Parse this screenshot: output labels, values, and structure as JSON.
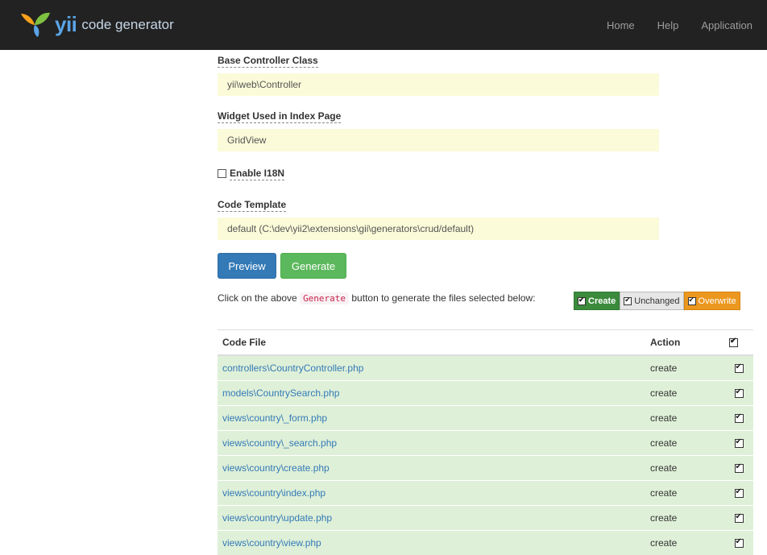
{
  "navbar": {
    "brand_logo": "yii",
    "brand_subtitle": "code generator",
    "links": [
      "Home",
      "Help",
      "Application"
    ]
  },
  "form": {
    "base_controller": {
      "label": "Base Controller Class",
      "value": "yii\\web\\Controller"
    },
    "widget": {
      "label": "Widget Used in Index Page",
      "value": "GridView"
    },
    "i18n": {
      "label": "Enable I18N",
      "checked": false
    },
    "template": {
      "label": "Code Template",
      "value": "default (C:\\dev\\yii2\\extensions\\gii\\generators\\crud/default)"
    }
  },
  "buttons": {
    "preview": "Preview",
    "generate": "Generate"
  },
  "hint": {
    "before": "Click on the above ",
    "code": "Generate",
    "after": " button to generate the files selected below:"
  },
  "legend": {
    "create": "Create",
    "unchanged": "Unchanged",
    "overwrite": "Overwrite"
  },
  "table": {
    "headers": {
      "file": "Code File",
      "action": "Action"
    },
    "rows": [
      {
        "file": "controllers\\CountryController.php",
        "action": "create"
      },
      {
        "file": "models\\CountrySearch.php",
        "action": "create"
      },
      {
        "file": "views\\country\\_form.php",
        "action": "create"
      },
      {
        "file": "views\\country\\_search.php",
        "action": "create"
      },
      {
        "file": "views\\country\\create.php",
        "action": "create"
      },
      {
        "file": "views\\country\\index.php",
        "action": "create"
      },
      {
        "file": "views\\country\\update.php",
        "action": "create"
      },
      {
        "file": "views\\country\\view.php",
        "action": "create"
      }
    ]
  },
  "colors": {
    "navbar": "#222222",
    "create_row": "#dff0d8",
    "input_bg": "#fbfbd9",
    "primary": "#337ab7",
    "success": "#5cb85c",
    "warning": "#ec971f"
  }
}
